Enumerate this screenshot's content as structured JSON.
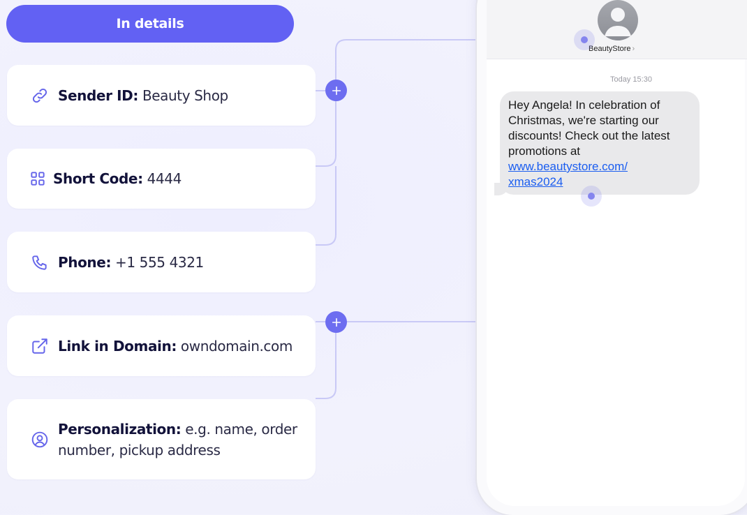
{
  "header": {
    "title": "In details"
  },
  "features": [
    {
      "icon": "link-icon",
      "label": "Sender ID:",
      "value": "Beauty Shop"
    },
    {
      "icon": "grid-icon",
      "label": "Short Code:",
      "value": "4444"
    },
    {
      "icon": "phone-icon",
      "label": "Phone:",
      "value": "+1 555 4321"
    },
    {
      "icon": "external-link-icon",
      "label": "Link in Domain:",
      "value": "owndomain.com"
    },
    {
      "icon": "user-circle-icon",
      "label": "Personalization:",
      "value": "e.g. name, order number, pickup address"
    }
  ],
  "phone": {
    "contact_name": "BeautyStore",
    "contact_chevron": "›",
    "timestamp": "Today 15:30",
    "message_text": "Hey Angela! In celebration of Christmas, we're starting our discounts! Check out the latest promotions at",
    "message_link_line1": "www.beautystore.com/",
    "message_link_line2": "xmas2024"
  },
  "colors": {
    "accent": "#6261f3",
    "background": "#f2f2fd",
    "connector": "#c9c9f6",
    "bubble": "#e9e9eb",
    "link": "#1a5df0"
  }
}
